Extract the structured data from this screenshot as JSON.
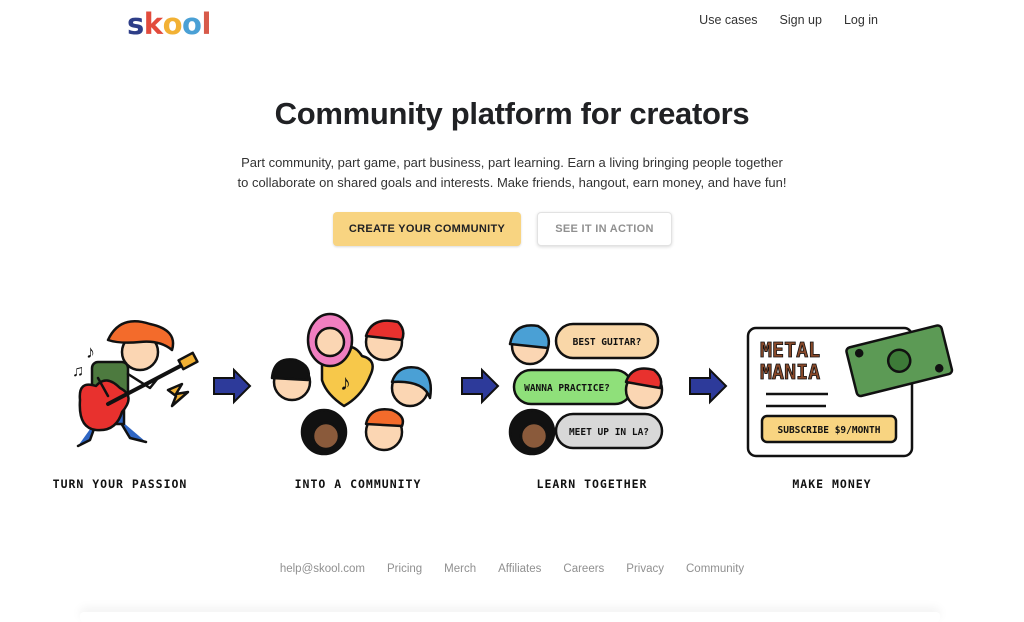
{
  "brand": {
    "letters": [
      "s",
      "k",
      "o",
      "o",
      "l"
    ],
    "colors": [
      "#2e3e88",
      "#e24b3c",
      "#f2b134",
      "#4aa0d5",
      "#d75a4a"
    ]
  },
  "nav": {
    "use_cases": "Use cases",
    "sign_up": "Sign up",
    "log_in": "Log in"
  },
  "hero": {
    "title": "Community platform for creators",
    "subtitle_line1": "Part community, part game, part business, part learning. Earn a living bringing people together",
    "subtitle_line2": "to collaborate on shared goals and interests. Make friends, hangout, earn money, and have fun!",
    "primary_button": "CREATE YOUR COMMUNITY",
    "secondary_button": "SEE IT IN ACTION"
  },
  "steps": [
    {
      "caption": "TURN YOUR PASSION"
    },
    {
      "caption": "INTO A COMMUNITY"
    },
    {
      "caption": "LEARN TOGETHER",
      "bubbles": [
        "BEST GUITAR?",
        "WANNA PRACTICE?",
        "MEET UP IN LA?"
      ]
    },
    {
      "caption": "MAKE MONEY",
      "card_title_1": "METAL",
      "card_title_2": "MANIA",
      "card_button": "SUBSCRIBE $9/MONTH"
    }
  ],
  "footer": {
    "links": [
      "help@skool.com",
      "Pricing",
      "Merch",
      "Affiliates",
      "Careers",
      "Privacy",
      "Community"
    ]
  },
  "colors": {
    "accent_button": "#f8d481",
    "arrow": "#2d3a9a",
    "bubble_pink": "#f9d7a8",
    "bubble_green": "#8fe07a",
    "bubble_grey": "#d8d8d8",
    "money": "#5c9a55"
  }
}
